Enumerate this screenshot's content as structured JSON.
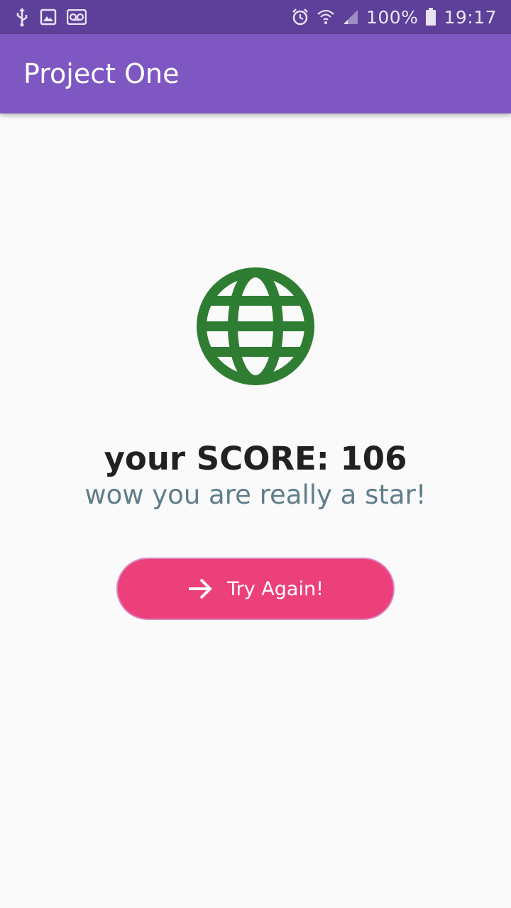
{
  "status_bar": {
    "battery": "100%",
    "time": "19:17",
    "left_icons": [
      "usb-icon",
      "image-icon",
      "voicemail-icon"
    ],
    "right_icons": [
      "alarm-icon",
      "wifi-icon",
      "signal-icon",
      "battery-icon"
    ]
  },
  "app_bar": {
    "title": "Project One",
    "color": "#7e57c2"
  },
  "result": {
    "icon": "globe-icon",
    "icon_color": "#2e7d32",
    "score_text": "your SCORE: 106",
    "message": "wow you are really a star!"
  },
  "actions": {
    "try_again_label": "Try Again!",
    "try_again_icon": "arrow-forward-icon",
    "button_color": "#ec407a"
  }
}
